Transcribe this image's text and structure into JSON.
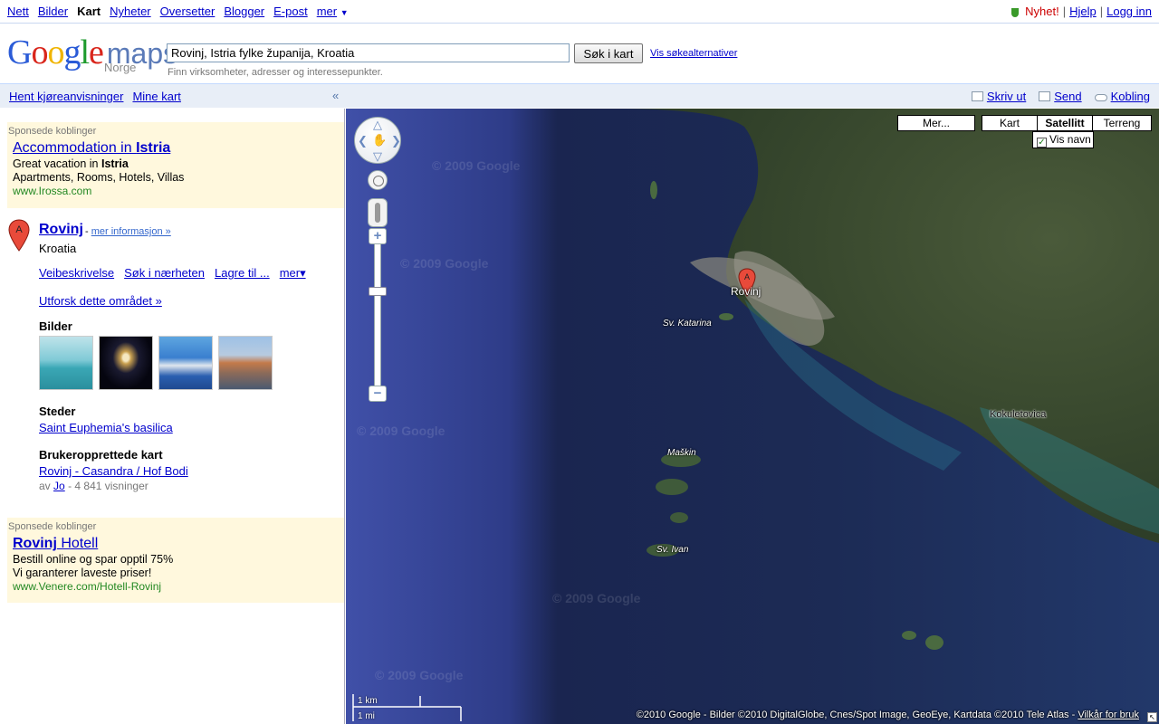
{
  "topnav": {
    "items": [
      {
        "label": "Nett"
      },
      {
        "label": "Bilder"
      },
      {
        "label": "Kart"
      },
      {
        "label": "Nyheter"
      },
      {
        "label": "Oversetter"
      },
      {
        "label": "Blogger"
      },
      {
        "label": "E-post"
      },
      {
        "label": "mer"
      }
    ],
    "more_caret": "▼",
    "right": {
      "new": "Nyhet!",
      "help": "Hjelp",
      "login": "Logg inn",
      "sep": "|"
    }
  },
  "header": {
    "logo_google": "Google",
    "logo_maps": "maps",
    "logo_country": "Norge",
    "search_value": "Rovinj, Istria fylke županija, Kroatia",
    "search_button": "Søk i kart",
    "advanced_link": "Vis søkealternativer",
    "search_hint": "Finn virksomheter, adresser og interessepunkter."
  },
  "band": {
    "directions": "Hent kjøreanvisninger",
    "my_maps": "Mine kart",
    "collapse": "«",
    "print": "Skriv ut",
    "send": "Send",
    "link": "Kobling"
  },
  "sidebar": {
    "sponsored_top": {
      "label": "Sponsede koblinger",
      "title_pre": "Accommodation in ",
      "title_bold": "Istria",
      "line1_pre": "Great vacation in ",
      "line1_bold": "Istria",
      "line2": "Apartments, Rooms, Hotels, Villas",
      "url": "www.Irossa.com"
    },
    "result": {
      "marker": "A",
      "title": "Rovinj",
      "more_sep": "-",
      "more": "mer informasjon »",
      "country": "Kroatia",
      "actions": [
        "Veibeskrivelse",
        "Søk i nærheten",
        "Lagre til ...",
        "mer▾"
      ],
      "explore": "Utforsk dette området »"
    },
    "photos_heading": "Bilder",
    "places_heading": "Steder",
    "places_link": "Saint Euphemia's basilica",
    "user_maps_heading": "Brukeropprettede kart",
    "user_map_link": "Rovinj - Casandra / Hof Bodi",
    "user_map_by": "av",
    "user_map_author": "Jo",
    "user_map_views": "- 4 841 visninger",
    "sponsored_bottom": {
      "label": "Sponsede koblinger",
      "title_bold": "Rovinj",
      "title_rest": " Hotell",
      "line1": "Bestill online og spar opptil 75%",
      "line2": "Vi garanterer laveste priser!",
      "url": "www.Venere.com/Hotell-Rovinj"
    }
  },
  "map": {
    "types": [
      "Mer...",
      "Kart",
      "Satellitt",
      "Terreng"
    ],
    "selected_type": "Satellitt",
    "labels_option": "Vis navn",
    "labels_checked": true,
    "pin_letter": "A",
    "labels": {
      "rovinj": "Rovinj",
      "katarina": "Sv. Katarina",
      "maskin": "Maškin",
      "ivan": "Sv. Ivan",
      "kokuletovica": "Kokuletovica"
    },
    "watermark": "© 2009 Google",
    "scale_km": "1 km",
    "scale_mi": "1 mi",
    "copyright": "©2010 Google - Bilder ©2010 DigitalGlobe, Cnes/Spot Image, GeoEye, Kartdata ©2010 Tele Atlas - ",
    "terms": "Vilkår for bruk",
    "resize_glyph": "↖"
  },
  "colors": {
    "link": "#0000cc",
    "sponsor_bg": "#fff8dd",
    "band_bg": "#e8eef7",
    "new_red": "#cc0000",
    "url_green": "#228822"
  }
}
